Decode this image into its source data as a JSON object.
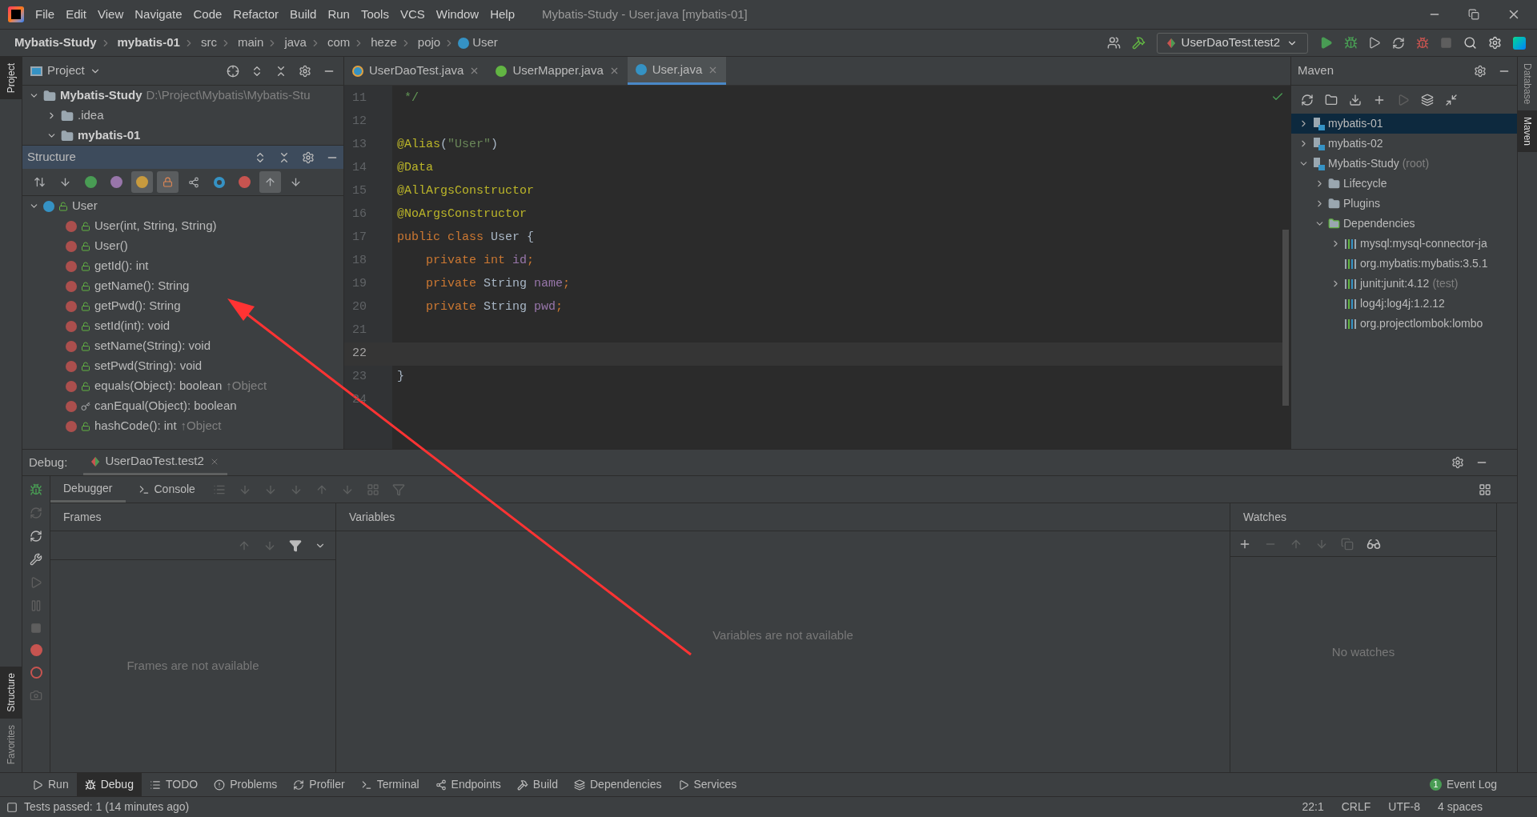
{
  "window": {
    "title": "Mybatis-Study - User.java [mybatis-01]",
    "menu": [
      "File",
      "Edit",
      "View",
      "Navigate",
      "Code",
      "Refactor",
      "Build",
      "Run",
      "Tools",
      "VCS",
      "Window",
      "Help"
    ]
  },
  "breadcrumbs": [
    {
      "label": "Mybatis-Study",
      "kind": "module"
    },
    {
      "label": "mybatis-01",
      "kind": "module"
    },
    {
      "label": "src",
      "kind": "dir"
    },
    {
      "label": "main",
      "kind": "dir"
    },
    {
      "label": "java",
      "kind": "dir"
    },
    {
      "label": "com",
      "kind": "dir"
    },
    {
      "label": "heze",
      "kind": "dir"
    },
    {
      "label": "pojo",
      "kind": "dir"
    },
    {
      "label": "User",
      "kind": "class"
    }
  ],
  "toolbar": {
    "run_config": "UserDaoTest.test2"
  },
  "left_stripe": [
    {
      "label": "Project",
      "selected": true
    },
    {
      "label": "Structure",
      "selected": true
    },
    {
      "label": "Favorites",
      "selected": false
    }
  ],
  "right_stripe": [
    {
      "label": "Database",
      "selected": false
    },
    {
      "label": "Maven",
      "selected": true
    }
  ],
  "project_panel": {
    "title": "Project",
    "tree": [
      {
        "label": "Mybatis-Study",
        "path": "D:\\Project\\Mybatis\\Mybatis-Stu",
        "expanded": true,
        "children": [
          {
            "label": ".idea",
            "expanded": false
          },
          {
            "label": "mybatis-01",
            "expanded": true
          }
        ]
      }
    ]
  },
  "structure_panel": {
    "title": "Structure",
    "filters": [
      {
        "kind": "sort-visibility",
        "selected": false
      },
      {
        "kind": "sort-alpha",
        "selected": false
      },
      {
        "kind": "inherited",
        "selected": false
      },
      {
        "kind": "properties",
        "selected": false
      },
      {
        "kind": "fields",
        "selected": true
      },
      {
        "kind": "non-public",
        "selected": true
      },
      {
        "kind": "split",
        "selected": false
      },
      {
        "kind": "anonymous",
        "selected": false
      },
      {
        "kind": "lambdas",
        "selected": false
      },
      {
        "kind": "scroll-from",
        "selected": true
      },
      {
        "kind": "scroll-to",
        "selected": false
      }
    ],
    "tree": [
      {
        "label": "User",
        "expanded": true,
        "children": [
          {
            "label": "User(int, String, String)",
            "kind": "public"
          },
          {
            "label": "User()",
            "kind": "public"
          },
          {
            "label": "getId(): int",
            "kind": "public"
          },
          {
            "label": "getName(): String",
            "kind": "public"
          },
          {
            "label": "getPwd(): String",
            "kind": "public"
          },
          {
            "label": "setId(int): void",
            "kind": "public"
          },
          {
            "label": "setName(String): void",
            "kind": "public"
          },
          {
            "label": "setPwd(String): void",
            "kind": "public"
          },
          {
            "label": "equals(Object): boolean",
            "inherited": "↑Object",
            "kind": "public"
          },
          {
            "label": "canEqual(Object): boolean",
            "kind": "protected"
          },
          {
            "label": "hashCode(): int",
            "inherited": "↑Object",
            "kind": "public"
          }
        ]
      }
    ]
  },
  "editor": {
    "tabs": [
      {
        "label": "UserDaoTest.java",
        "kind": "test",
        "selected": false
      },
      {
        "label": "UserMapper.java",
        "kind": "interface",
        "selected": false
      },
      {
        "label": "User.java",
        "kind": "class",
        "selected": true
      }
    ],
    "lines": [
      {
        "number": "11",
        "current": false,
        "tokens": [
          {
            "text": " */",
            "kind": "comment"
          }
        ]
      },
      {
        "number": "12",
        "current": false
      },
      {
        "number": "13",
        "current": false,
        "tokens": [
          {
            "text": "@Alias",
            "kind": "annotation"
          },
          {
            "text": "(",
            "kind": "plain"
          },
          {
            "text": "\"User\"",
            "kind": "string"
          },
          {
            "text": ")",
            "kind": "plain"
          }
        ]
      },
      {
        "number": "14",
        "current": false,
        "tokens": [
          {
            "text": "@Data",
            "kind": "annotation"
          }
        ]
      },
      {
        "number": "15",
        "current": false,
        "tokens": [
          {
            "text": "@AllArgsConstructor",
            "kind": "annotation"
          }
        ]
      },
      {
        "number": "16",
        "current": false,
        "tokens": [
          {
            "text": "@NoArgsConstructor",
            "kind": "annotation"
          }
        ]
      },
      {
        "number": "17",
        "current": false,
        "tokens": [
          {
            "text": "public class ",
            "kind": "keyword"
          },
          {
            "text": "User {",
            "kind": "plain"
          }
        ]
      },
      {
        "number": "18",
        "current": false,
        "tokens": [
          {
            "text": "    private int ",
            "kind": "keyword"
          },
          {
            "text": "id",
            "kind": "field"
          },
          {
            "text": ";",
            "kind": "keyword"
          }
        ]
      },
      {
        "number": "19",
        "current": false,
        "tokens": [
          {
            "text": "    private ",
            "kind": "keyword"
          },
          {
            "text": "String ",
            "kind": "plain"
          },
          {
            "text": "name",
            "kind": "field"
          },
          {
            "text": ";",
            "kind": "keyword"
          }
        ]
      },
      {
        "number": "20",
        "current": false,
        "tokens": [
          {
            "text": "    private ",
            "kind": "keyword"
          },
          {
            "text": "String ",
            "kind": "plain"
          },
          {
            "text": "pwd",
            "kind": "field"
          },
          {
            "text": ";",
            "kind": "keyword"
          }
        ]
      },
      {
        "number": "21",
        "current": false
      },
      {
        "number": "22",
        "current": true
      },
      {
        "number": "23",
        "current": false,
        "tokens": [
          {
            "text": "}",
            "kind": "plain"
          }
        ]
      },
      {
        "number": "24",
        "current": false
      }
    ]
  },
  "maven": {
    "title": "Maven",
    "tree": [
      {
        "label": "mybatis-01",
        "kind": "module",
        "expanded": false,
        "selected": true
      },
      {
        "label": "mybatis-02",
        "kind": "module",
        "expanded": false,
        "selected": false
      },
      {
        "label": "Mybatis-Study",
        "note": "(root)",
        "kind": "module",
        "expanded": true,
        "selected": false,
        "children": [
          {
            "label": "Lifecycle",
            "kind": "folder",
            "expanded": false,
            "selected": false
          },
          {
            "label": "Plugins",
            "kind": "folder",
            "expanded": false,
            "selected": false
          },
          {
            "label": "Dependencies",
            "kind": "deps",
            "expanded": true,
            "selected": false,
            "children": [
              {
                "label": "mysql:mysql-connector-ja",
                "kind": "lib",
                "expanded": false,
                "selected": false
              },
              {
                "label": "org.mybatis:mybatis:3.5.1",
                "kind": "lib",
                "selected": false
              },
              {
                "label": "junit:junit:4.12",
                "note": "(test)",
                "kind": "lib",
                "expanded": false,
                "selected": false
              },
              {
                "label": "log4j:log4j:1.2.12",
                "kind": "lib",
                "selected": false
              },
              {
                "label": "org.projectlombok:lombo",
                "kind": "lib",
                "selected": false
              }
            ]
          }
        ]
      }
    ]
  },
  "debug": {
    "title": "Debug:",
    "session": "UserDaoTest.test2",
    "tabs": [
      {
        "label": "Debugger",
        "selected": true
      },
      {
        "label": "Console",
        "selected": false
      }
    ],
    "frames": {
      "title": "Frames",
      "empty": "Frames are not available"
    },
    "variables": {
      "title": "Variables",
      "empty": "Variables are not available"
    },
    "watches": {
      "title": "Watches",
      "empty": "No watches"
    }
  },
  "tool_tabs": [
    {
      "label": "Run",
      "selected": false
    },
    {
      "label": "Debug",
      "selected": true
    },
    {
      "label": "TODO",
      "selected": false
    },
    {
      "label": "Problems",
      "selected": false
    },
    {
      "label": "Profiler",
      "selected": false
    },
    {
      "label": "Terminal",
      "selected": false
    },
    {
      "label": "Endpoints",
      "selected": false
    },
    {
      "label": "Build",
      "selected": false
    },
    {
      "label": "Dependencies",
      "selected": false
    },
    {
      "label": "Services",
      "selected": false
    }
  ],
  "event_log": {
    "count": "1",
    "label": "Event Log"
  },
  "status_bar": {
    "message": "Tests passed: 1 (14 minutes ago)",
    "items": [
      "22:1",
      "CRLF",
      "UTF-8",
      "4 spaces"
    ]
  }
}
